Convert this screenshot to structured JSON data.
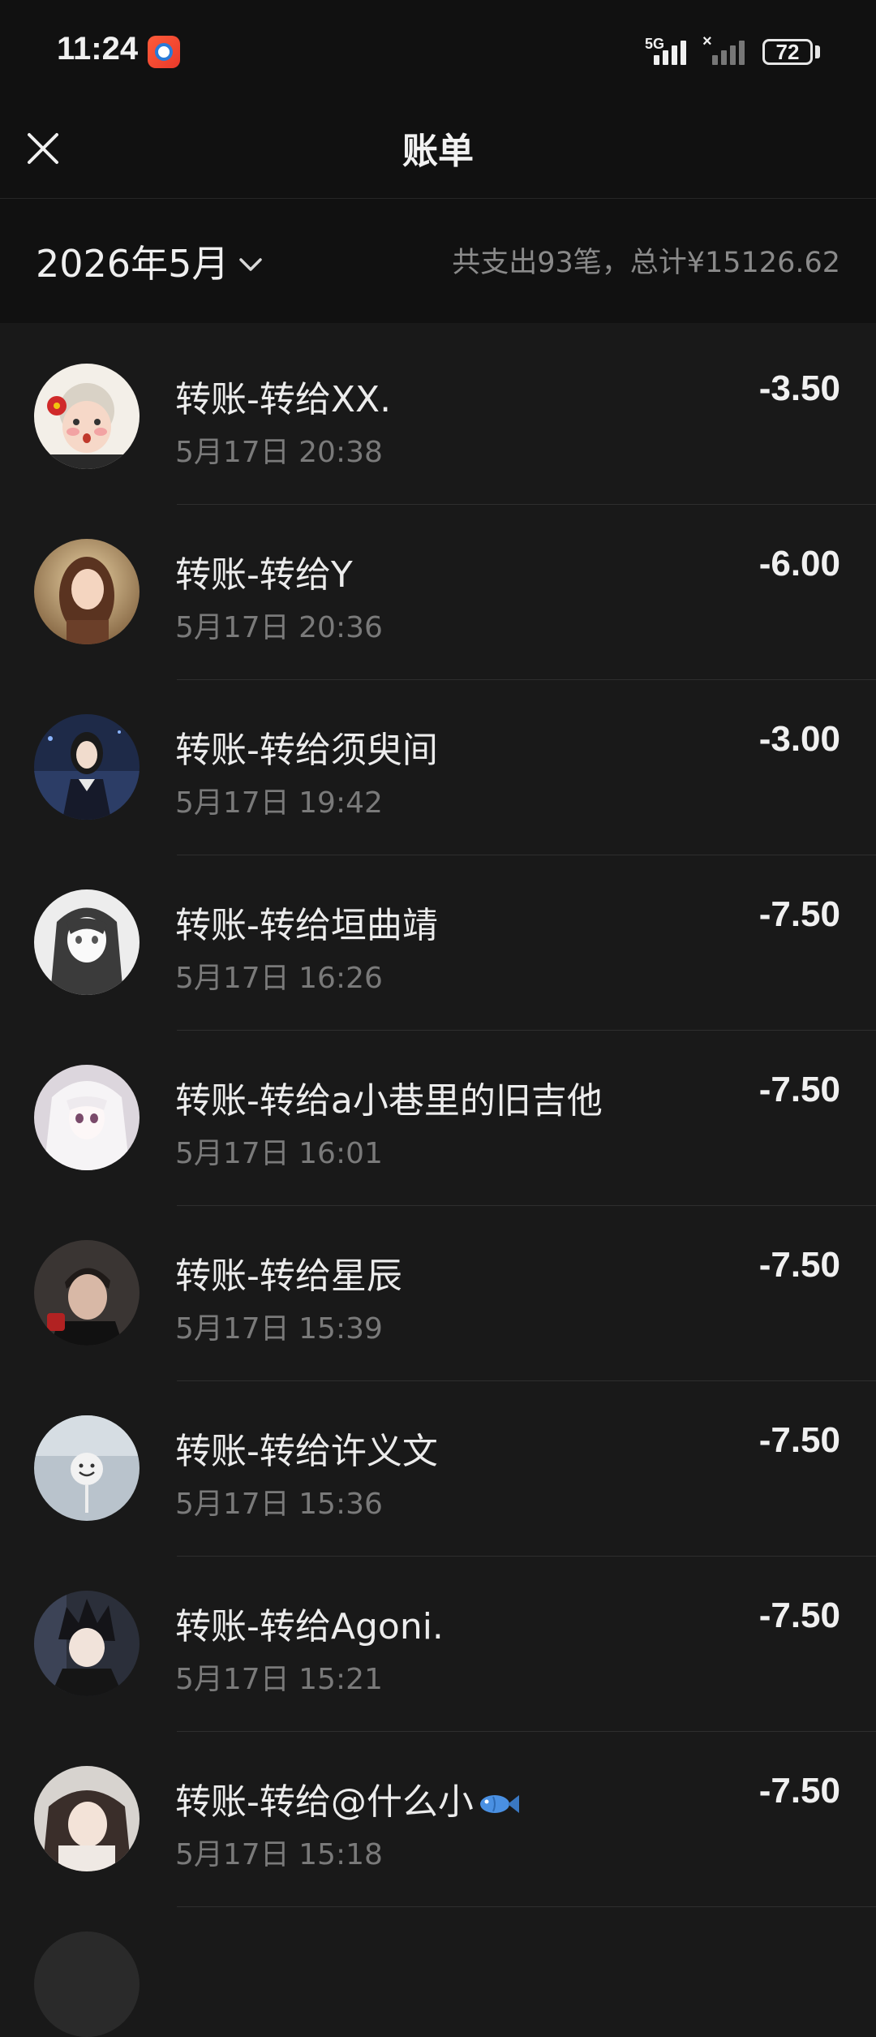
{
  "status_bar": {
    "time": "11:24",
    "network": "5G",
    "battery": "72"
  },
  "nav": {
    "title": "账单"
  },
  "filter": {
    "month": "2026年5月",
    "summary": "共支出93笔，总计¥15126.62"
  },
  "transactions": [
    {
      "title": "转账-转给XX.",
      "time": "5月17日 20:38",
      "amount": "-3.50",
      "avatar": "avatar-elderly-cartoon"
    },
    {
      "title": "转账-转给Y",
      "time": "5月17日 20:36",
      "amount": "-6.00",
      "avatar": "avatar-girl-warm"
    },
    {
      "title": "转账-转给须臾间",
      "time": "5月17日 19:42",
      "amount": "-3.00",
      "avatar": "avatar-girl-night"
    },
    {
      "title": "转账-转给垣曲靖",
      "time": "5月17日 16:26",
      "amount": "-7.50",
      "avatar": "avatar-anime-sketch"
    },
    {
      "title": "转账-转给a小巷里的旧吉他",
      "time": "5月17日 16:01",
      "amount": "-7.50",
      "avatar": "avatar-anime-white"
    },
    {
      "title": "转账-转给星辰",
      "time": "5月17日 15:39",
      "amount": "-7.50",
      "avatar": "avatar-boy-selfie"
    },
    {
      "title": "转账-转给许义文",
      "time": "5月17日 15:36",
      "amount": "-7.50",
      "avatar": "avatar-smiley-sky"
    },
    {
      "title": "转账-转给Agoni.",
      "time": "5月17日 15:21",
      "amount": "-7.50",
      "avatar": "avatar-anime-dark"
    },
    {
      "title": "转账-转给@什么小",
      "title_emoji": "fish-icon",
      "time": "5月17日 15:18",
      "amount": "-7.50",
      "avatar": "avatar-girl-blur"
    }
  ]
}
